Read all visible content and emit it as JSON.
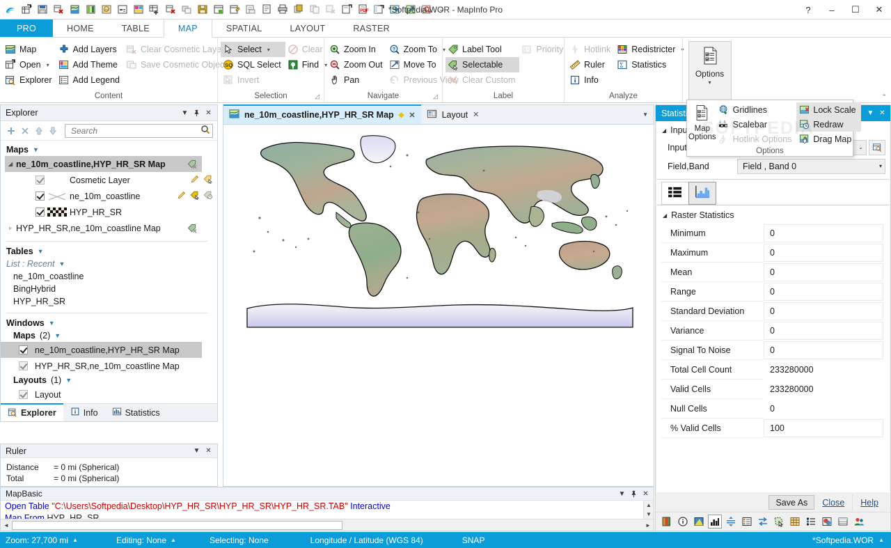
{
  "window": {
    "title": "*Softpedia.WOR - MapInfo Pro",
    "help_glyph": "?",
    "minimize_glyph": "–",
    "maximize_glyph": "☐",
    "close_glyph": "✕"
  },
  "quick_access": {
    "more_glyph": "⌄",
    "icons": [
      "mapinfo-logo-icon",
      "new-table-icon",
      "open-table-icon",
      "close-table-icon",
      "new-map-icon",
      "new-thematic-map-icon",
      "new-legend-icon",
      "new-browser-icon",
      "new-layout-icon",
      "add-layout-frame-icon",
      "remove-layout-frame-icon",
      "copy-window-icon",
      "save-table-icon",
      "save-workspace-icon",
      "save-window-as-icon",
      "save-copy-as-icon",
      "print-preview-icon",
      "print-icon",
      "export-icon",
      "duplicate-icon",
      "undo-icon",
      "import-icon",
      "export-pdf-icon",
      "new-window-icon",
      "run-mapbasic-icon",
      "share-icon",
      "find-icon"
    ]
  },
  "ribbon": {
    "tabs": [
      {
        "label": "PRO",
        "style": "pro"
      },
      {
        "label": "HOME",
        "style": ""
      },
      {
        "label": "TABLE",
        "style": ""
      },
      {
        "label": "MAP",
        "style": "active"
      },
      {
        "label": "SPATIAL",
        "style": ""
      },
      {
        "label": "LAYOUT",
        "style": ""
      },
      {
        "label": "RASTER",
        "style": ""
      }
    ],
    "collapse_glyph": "⌃",
    "groups": [
      {
        "label": "Content",
        "dialog_launcher": false,
        "columns": [
          [
            {
              "label": "Map",
              "icon": "map-icon",
              "state": "normal",
              "caret": false
            },
            {
              "label": "Open",
              "icon": "open-icon",
              "state": "normal",
              "caret": true
            },
            {
              "label": "Explorer",
              "icon": "explorer-icon",
              "state": "normal",
              "caret": false
            }
          ],
          [
            {
              "label": "Add Layers",
              "icon": "add-layers-icon",
              "state": "normal",
              "caret": false
            },
            {
              "label": "Add Theme",
              "icon": "add-theme-icon",
              "state": "normal",
              "caret": false
            },
            {
              "label": "Add Legend",
              "icon": "add-legend-icon",
              "state": "normal",
              "caret": false
            }
          ],
          [
            {
              "label": "Clear Cosmetic Layer",
              "icon": "clear-cosmetic-layer-icon",
              "state": "disabled",
              "caret": false
            },
            {
              "label": "Save Cosmetic Objects",
              "icon": "save-cosmetic-objects-icon",
              "state": "disabled",
              "caret": false
            }
          ]
        ]
      },
      {
        "label": "Selection",
        "dialog_launcher": true,
        "columns": [
          [
            {
              "label": "Select",
              "icon": "select-arrow-icon",
              "state": "selected",
              "caret": true
            },
            {
              "label": "SQL Select",
              "icon": "sql-select-icon",
              "state": "normal",
              "caret": false
            },
            {
              "label": "Invert",
              "icon": "invert-selection-icon",
              "state": "disabled",
              "caret": false
            }
          ],
          [
            {
              "label": "Clear",
              "icon": "clear-selection-icon",
              "state": "disabled",
              "caret": false
            },
            {
              "label": "Find",
              "icon": "find-icon",
              "state": "normal",
              "caret": true
            }
          ]
        ]
      },
      {
        "label": "Navigate",
        "dialog_launcher": true,
        "columns": [
          [
            {
              "label": "Zoom In",
              "icon": "zoom-in-icon",
              "state": "normal",
              "caret": false
            },
            {
              "label": "Zoom Out",
              "icon": "zoom-out-icon",
              "state": "normal",
              "caret": false
            },
            {
              "label": "Pan",
              "icon": "pan-hand-icon",
              "state": "normal",
              "caret": false
            }
          ],
          [
            {
              "label": "Zoom To",
              "icon": "zoom-to-icon",
              "state": "normal",
              "caret": true
            },
            {
              "label": "Move To",
              "icon": "move-to-icon",
              "state": "normal",
              "caret": false
            },
            {
              "label": "Previous View",
              "icon": "previous-view-icon",
              "state": "disabled",
              "caret": false
            }
          ]
        ]
      },
      {
        "label": "Label",
        "dialog_launcher": false,
        "columns": [
          [
            {
              "label": "Label Tool",
              "icon": "label-tool-icon",
              "state": "normal",
              "caret": false
            },
            {
              "label": "Selectable",
              "icon": "selectable-icon",
              "state": "selected",
              "caret": false
            },
            {
              "label": "Clear Custom",
              "icon": "clear-custom-icon",
              "state": "disabled",
              "caret": false
            }
          ],
          [
            {
              "label": "Priority",
              "icon": "priority-icon",
              "state": "disabled",
              "caret": false
            }
          ]
        ]
      },
      {
        "label": "Analyze",
        "dialog_launcher": false,
        "columns": [
          [
            {
              "label": "Hotlink",
              "icon": "hotlink-icon",
              "state": "disabled",
              "caret": false
            },
            {
              "label": "Ruler",
              "icon": "ruler-icon",
              "state": "normal",
              "caret": false
            },
            {
              "label": "Info",
              "icon": "info-icon",
              "state": "normal",
              "caret": false
            }
          ],
          [
            {
              "label": "Redistricter",
              "icon": "redistricter-icon",
              "state": "normal",
              "caret": true
            },
            {
              "label": "Statistics",
              "icon": "statistics-icon",
              "state": "normal",
              "caret": false
            }
          ]
        ]
      }
    ],
    "options_button": {
      "label": "Options",
      "icon": "map-options-icon",
      "caret_glyph": "▾"
    }
  },
  "options_flyout": {
    "group_label": "Options",
    "watermark": "SOFTPEDIA",
    "big_button": {
      "label_line1": "Map",
      "label_line2": "Options",
      "icon": "map-options-icon"
    },
    "column_a": [
      {
        "label": "Gridlines",
        "icon": "gridlines-icon",
        "state": "normal"
      },
      {
        "label": "Scalebar",
        "icon": "scalebar-icon",
        "state": "normal"
      },
      {
        "label": "Hotlink Options",
        "icon": "hotlink-options-icon",
        "state": "disabled"
      }
    ],
    "column_b": [
      {
        "label": "Lock Scale",
        "icon": "lock-scale-icon",
        "state": "highlight"
      },
      {
        "label": "Redraw",
        "icon": "redraw-icon",
        "state": "highlight"
      },
      {
        "label": "Drag Map",
        "icon": "drag-map-icon",
        "state": "normal"
      }
    ]
  },
  "explorer": {
    "title": "Explorer",
    "head_buttons": [
      "chevron-down-icon",
      "pin-icon",
      "close-icon"
    ],
    "toolbar_icons": [
      "add-icon",
      "remove-icon",
      "move-up-icon",
      "move-down-icon"
    ],
    "search": {
      "placeholder": "Search",
      "value": "",
      "icon": "search-icon"
    },
    "maps_section": {
      "label": "Maps",
      "caret_glyph": "▼",
      "nodes": [
        {
          "label": "ne_10m_coastline,HYP_HR_SR Map",
          "selected": true,
          "expanded": true,
          "twisty": "◢",
          "right_icon": "layer-selectable-off-icon",
          "children": [
            {
              "label": "Cosmetic Layer",
              "checked": true,
              "checkbox_dim": true,
              "swatch": "none",
              "icons": [
                "edit-pencil-icon",
                "selectable-icon"
              ]
            },
            {
              "label": "ne_10m_coastline",
              "checked": true,
              "checkbox_dim": false,
              "swatch": "line",
              "icons": [
                "edit-pencil-icon",
                "selectable-on-icon",
                "label-visibility-icon"
              ]
            },
            {
              "label": "HYP_HR_SR",
              "checked": true,
              "checkbox_dim": false,
              "swatch": "raster",
              "icons": []
            }
          ]
        },
        {
          "label": "HYP_HR_SR,ne_10m_coastline Map",
          "selected": false,
          "expanded": false,
          "twisty": "▹",
          "right_icon": "layer-selectable-off-icon",
          "children": []
        }
      ]
    },
    "tables_section": {
      "label": "Tables",
      "caret_glyph": "▼",
      "list_mode": "List : Recent",
      "list_mode_caret": "▼",
      "items": [
        "ne_10m_coastline",
        "BingHybrid",
        "HYP_HR_SR"
      ]
    },
    "windows_section": {
      "label": "Windows",
      "caret_glyph": "▼",
      "maps_group": {
        "label": "Maps",
        "count": "(2)",
        "caret_glyph": "▼"
      },
      "maps_items": [
        {
          "label": "ne_10m_coastline,HYP_HR_SR Map",
          "checked": true,
          "dim": false,
          "selected": true
        },
        {
          "label": "HYP_HR_SR,ne_10m_coastline Map",
          "checked": true,
          "dim": true,
          "selected": false
        }
      ],
      "layouts_group": {
        "label": "Layouts",
        "count": "(1)",
        "caret_glyph": "▼"
      },
      "layouts_items": [
        {
          "label": "Layout",
          "checked": true,
          "dim": true,
          "selected": false
        }
      ]
    },
    "bottom_tabs": [
      {
        "label": "Explorer",
        "icon": "explorer-icon",
        "active": true
      },
      {
        "label": "Info",
        "icon": "info-icon",
        "active": false
      },
      {
        "label": "Statistics",
        "icon": "statistics-icon",
        "active": false
      }
    ]
  },
  "ruler": {
    "title": "Ruler",
    "head_buttons": [
      "chevron-down-icon",
      "close-icon"
    ],
    "rows": [
      {
        "key": "Distance",
        "value": "= 0 mi (Spherical)"
      },
      {
        "key": "Total",
        "value": "= 0 mi (Spherical)"
      }
    ]
  },
  "mapbasic": {
    "title": "MapBasic",
    "head_buttons": [
      "chevron-down-icon",
      "pin-icon",
      "close-icon"
    ],
    "lines": [
      {
        "keyword": "Open Table",
        "string": "\"C:\\Users\\Softpedia\\Desktop\\HYP_HR_SR\\HYP_HR_SR\\HYP_HR_SR.TAB\"",
        "tail": " Interactive"
      },
      {
        "keyword": "Map From",
        "string": "HYP_HR_SR",
        "tail": ""
      }
    ],
    "scroll_up_glyph": "▲",
    "scroll_down_glyph": "▼",
    "scroll_left_glyph": "◄",
    "scroll_right_glyph": "►"
  },
  "document_tabs": {
    "tabs": [
      {
        "label": "ne_10m_coastline,HYP_HR_SR Map",
        "icon": "map-window-icon",
        "active": true,
        "modified_glyph": "◆",
        "close_glyph": "✕"
      },
      {
        "label": "Layout",
        "icon": "layout-window-icon",
        "active": false,
        "modified_glyph": "",
        "close_glyph": "✕"
      }
    ],
    "overflow_glyph": "▼"
  },
  "map": {
    "name": "world-hypsometric-raster-map",
    "description": "World map raster, hypsometric tint with coastline overlay"
  },
  "statistics": {
    "title": "Statistics",
    "head_buttons": [
      "chevron-down-icon",
      "close-icon"
    ],
    "input_section": {
      "label": "Input",
      "tri_glyph": "◢",
      "rows": [
        {
          "label": "Input",
          "value": "",
          "type": "select-browse"
        },
        {
          "label": "Field,Band",
          "value": "Field , Band 0",
          "type": "select"
        }
      ],
      "browse_icon": "browse-folder-icon",
      "caret_glyph": "⌄"
    },
    "view_tabs": [
      {
        "icon": "list-view-icon",
        "active": false
      },
      {
        "icon": "histogram-view-icon",
        "active": true
      }
    ],
    "grid_title": "Raster Statistics",
    "grid_tri_glyph": "◢",
    "rows": [
      {
        "key": "Minimum",
        "value": "0"
      },
      {
        "key": "Maximum",
        "value": "0"
      },
      {
        "key": "Mean",
        "value": "0"
      },
      {
        "key": "Range",
        "value": "0"
      },
      {
        "key": "Standard Deviation",
        "value": "0"
      },
      {
        "key": "Variance",
        "value": "0"
      },
      {
        "key": "Signal To Noise",
        "value": "0"
      },
      {
        "key": "Total Cell Count",
        "value": "233280000"
      },
      {
        "key": "Valid Cells",
        "value": "233280000"
      },
      {
        "key": "Null Cells",
        "value": "0"
      },
      {
        "key": "% Valid Cells",
        "value": "100"
      }
    ],
    "footer": {
      "save_as": "Save As",
      "close": "Close",
      "help": "Help"
    },
    "bottom_icons": [
      {
        "name": "color-palette-icon",
        "active": false
      },
      {
        "name": "info-circle-icon",
        "active": false
      },
      {
        "name": "image-adjust-icon",
        "active": false
      },
      {
        "name": "histogram-icon",
        "active": true
      },
      {
        "name": "balance-icon",
        "active": false
      },
      {
        "name": "list-properties-icon",
        "active": false
      },
      {
        "name": "swap-icon",
        "active": false
      },
      {
        "name": "region-select-icon",
        "active": false
      },
      {
        "name": "grid-table-icon",
        "active": false
      },
      {
        "name": "style-list-icon",
        "active": false
      },
      {
        "name": "raster-style-icon",
        "active": false
      },
      {
        "name": "browser-table-icon",
        "active": false
      },
      {
        "name": "users-icon",
        "active": false
      }
    ]
  },
  "statusbar": {
    "zoom": "Zoom: 27,700 mi",
    "zoom_caret": "▲",
    "editing": "Editing: None",
    "editing_caret": "▲",
    "selecting": "Selecting: None",
    "projection": "Longitude / Latitude (WGS 84)",
    "snap": "SNAP",
    "workspace": "*Softpedia.WOR",
    "workspace_caret": "▲"
  },
  "colors": {
    "accent": "#0b9dd9",
    "active_tab_text": "#1b7bbd",
    "panel_header": "#eef2f6",
    "selection_gray": "#c8c8c8",
    "link": "#1a4f8a",
    "mapbasic_keyword": "#0000cc",
    "mapbasic_string": "#cc0000"
  }
}
